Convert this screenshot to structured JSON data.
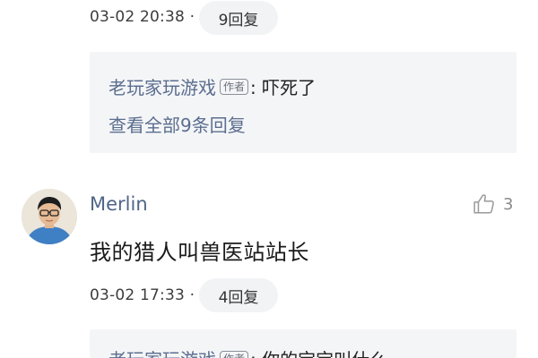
{
  "comment_top": {
    "timestamp": "03-02 20:38 ·",
    "reply_count_label": "9回复",
    "reply_preview": {
      "user": "老玩家玩游戏",
      "author_tag": "作者",
      "text": ": 吓死了",
      "view_all_label": "查看全部9条回复"
    }
  },
  "comment_merlin": {
    "username": "Merlin",
    "like_count": "3",
    "text": "我的猎人叫兽医站站长",
    "timestamp": "03-02 17:33 ·",
    "reply_count_label": "4回复",
    "reply_preview": {
      "user": "老玩家玩游戏",
      "author_tag": "作者",
      "text": ": 你的宝宝叫什么"
    }
  },
  "icons": {
    "like": "thumbs-up-icon",
    "avatar": "user-avatar"
  },
  "colors": {
    "username": "#4f6588",
    "link": "#5b6e8f",
    "reply_bg": "#f4f5f7",
    "pill_bg": "#f2f3f5"
  }
}
